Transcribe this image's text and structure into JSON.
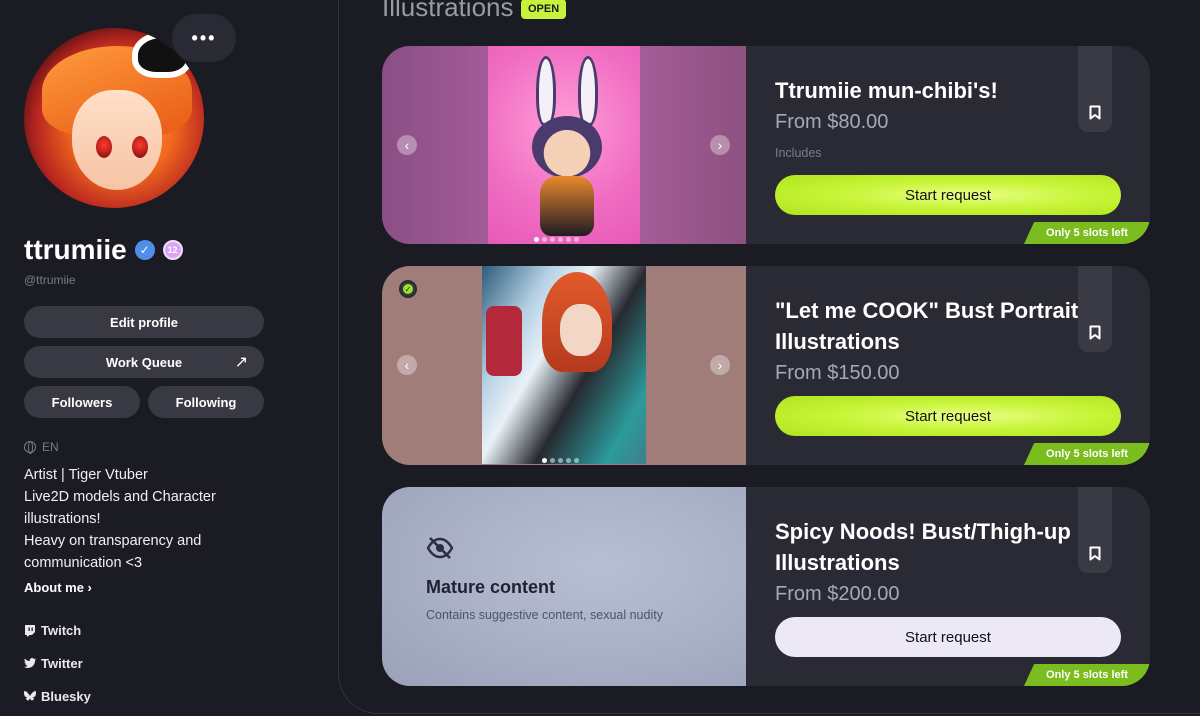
{
  "profile": {
    "more_label": "•••",
    "username": "ttrumiie",
    "verified_icon": "check",
    "level_badge": "12",
    "handle": "@ttrumiie",
    "edit_profile": "Edit profile",
    "work_queue": "Work Queue",
    "work_queue_icon": "↗",
    "followers": "Followers",
    "following": "Following",
    "language": "EN",
    "bio_lines": [
      "Artist | Tiger Vtuber",
      "Live2D models and Character",
      "illustrations!",
      "Heavy on transparency and",
      "communication <3"
    ],
    "about_me": "About me ›",
    "socials": [
      {
        "label": "Twitch",
        "icon": "twitch-icon"
      },
      {
        "label": "Twitter",
        "icon": "twitter-icon"
      },
      {
        "label": "Bluesky",
        "icon": "bluesky-icon"
      }
    ]
  },
  "section": {
    "title": "Illustrations",
    "status": "OPEN"
  },
  "cards": [
    {
      "title": "Ttrumiie mun-chibi's!",
      "price": "From $80.00",
      "includes": "Includes",
      "button": "Start request",
      "slots": "Only 5 slots left"
    },
    {
      "title": "\"Let me COOK\" Bust Portrait Illustrations",
      "price": "From $150.00",
      "button": "Start request",
      "slots": "Only 5 slots left"
    },
    {
      "title": "Spicy Noods! Bust/Thigh-up Illustrations",
      "price": "From $200.00",
      "button": "Start request",
      "slots": "Only 5 slots left",
      "mature_title": "Mature content",
      "mature_subtitle": "Contains suggestive content, sexual nudity"
    }
  ],
  "carousel": {
    "prev": "‹",
    "next": "›"
  },
  "colors": {
    "background": "#1b1b23",
    "card": "#2a2a34",
    "accent_lime": "#c6f23c",
    "slots_green": "#7bbd1e",
    "verified_blue": "#4f8fea"
  }
}
